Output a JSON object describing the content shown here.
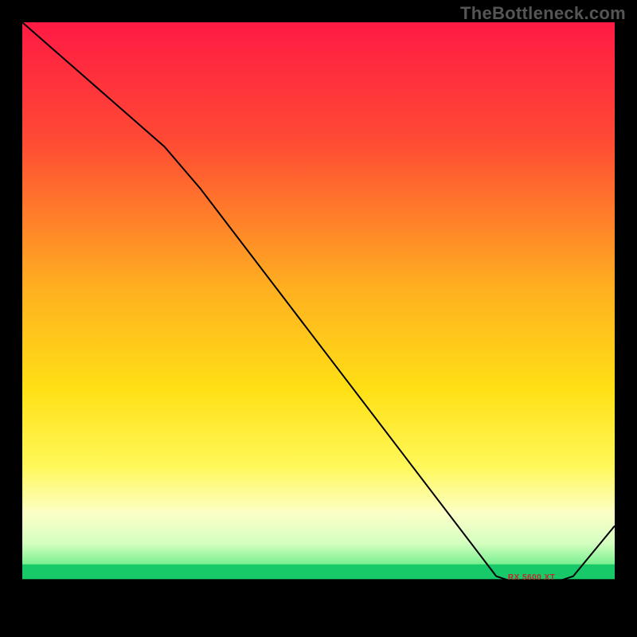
{
  "watermark": "TheBottleneck.com",
  "annotation_label": "RX 5600 XT",
  "chart_data": {
    "type": "line",
    "title": "",
    "xlabel": "",
    "ylabel": "",
    "xlim": [
      0,
      100
    ],
    "ylim": [
      0,
      100
    ],
    "gradient_stops": [
      {
        "offset": 0,
        "color": "#ff1a44"
      },
      {
        "offset": 20,
        "color": "#ff4a34"
      },
      {
        "offset": 45,
        "color": "#ffb020"
      },
      {
        "offset": 62,
        "color": "#ffe015"
      },
      {
        "offset": 75,
        "color": "#fff85a"
      },
      {
        "offset": 83,
        "color": "#fbffc8"
      },
      {
        "offset": 88,
        "color": "#d4ffc0"
      },
      {
        "offset": 92.5,
        "color": "#5eeb82"
      },
      {
        "offset": 94,
        "color": "#18c96a"
      },
      {
        "offset": 100,
        "color": "#000000"
      }
    ],
    "series": [
      {
        "name": "bottleneck-curve",
        "color": "#000000",
        "width": 2,
        "points": [
          {
            "x": 0,
            "y": 100
          },
          {
            "x": 24,
            "y": 79
          },
          {
            "x": 30,
            "y": 72
          },
          {
            "x": 80,
            "y": 6.5
          },
          {
            "x": 83,
            "y": 5.5
          },
          {
            "x": 90,
            "y": 5.5
          },
          {
            "x": 93,
            "y": 6.5
          },
          {
            "x": 100,
            "y": 15
          }
        ]
      }
    ],
    "annotation": {
      "label_key": "annotation_label",
      "x": 86,
      "y": 6.2
    }
  }
}
